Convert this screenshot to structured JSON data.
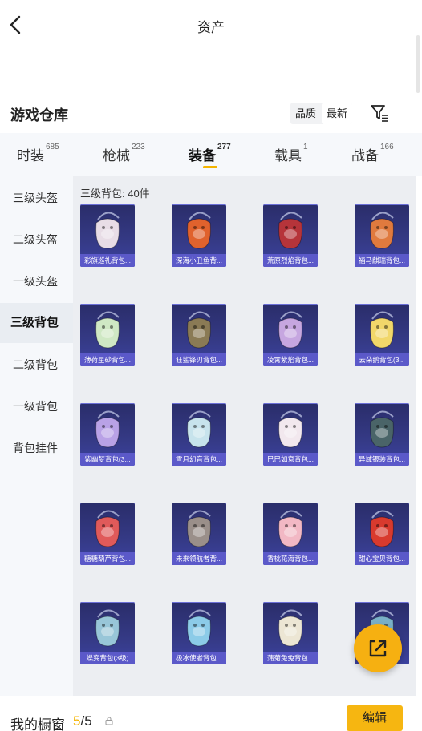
{
  "header": {
    "title": "资产",
    "back_icon": "chevron-left-icon"
  },
  "warehouse": {
    "title": "游戏仓库",
    "sort_options": [
      "品质",
      "最新"
    ],
    "sort_selected": "最新",
    "filter_icon": "filter-list-icon"
  },
  "tabs": [
    {
      "label": "时装",
      "count": "685"
    },
    {
      "label": "枪械",
      "count": "223"
    },
    {
      "label": "装备",
      "count": "277",
      "active": true
    },
    {
      "label": "载具",
      "count": "1"
    },
    {
      "label": "战备",
      "count": "166"
    }
  ],
  "sidebar": {
    "items": [
      {
        "label": "三级头盔"
      },
      {
        "label": "二级头盔"
      },
      {
        "label": "一级头盔"
      },
      {
        "label": "三级背包",
        "active": true
      },
      {
        "label": "二级背包"
      },
      {
        "label": "一级背包"
      },
      {
        "label": "背包挂件"
      }
    ]
  },
  "grid": {
    "count_label": "三级背包: 40件",
    "items": [
      {
        "name": "彩旗巡礼背包...",
        "color": "#e8dde6"
      },
      {
        "name": "深海小丑鱼背...",
        "color": "#e0622d"
      },
      {
        "name": "荒原烈焰背包...",
        "color": "#b6343a"
      },
      {
        "name": "福马麒瑞背包...",
        "color": "#e07a3e"
      },
      {
        "name": "薄荷星砂背包...",
        "color": "#cfe8c4"
      },
      {
        "name": "狂鲨锋刃背包...",
        "color": "#8a7a55"
      },
      {
        "name": "凌霄紫焰背包...",
        "color": "#c6a6e0"
      },
      {
        "name": "云朵鹅背包(3...",
        "color": "#f1d76a"
      },
      {
        "name": "紫幽梦背包(3...",
        "color": "#b9a2e6"
      },
      {
        "name": "雪月幻音背包...",
        "color": "#c7e3ec"
      },
      {
        "name": "巳巳如意背包...",
        "color": "#f2e8ee"
      },
      {
        "name": "异域银装背包...",
        "color": "#4a6468"
      },
      {
        "name": "糖糖葫芦背包...",
        "color": "#e05a5a"
      },
      {
        "name": "未来领航者背...",
        "color": "#9a8f8a"
      },
      {
        "name": "香桃花海背包...",
        "color": "#f2b8c4"
      },
      {
        "name": "甜心宝贝背包...",
        "color": "#d83a2e"
      },
      {
        "name": "蝶变背包(3级)",
        "color": "#98c6d8"
      },
      {
        "name": "极冰使者背包...",
        "color": "#8ccbe8"
      },
      {
        "name": "蒲菊兔兔背包...",
        "color": "#ece6d4"
      },
      {
        "name": "",
        "color": "#7ab0c8"
      }
    ]
  },
  "share_button": {
    "icon": "share-external-icon"
  },
  "bottom": {
    "showcase_label": "我的橱窗",
    "showcase_used": "5",
    "showcase_total": "/5",
    "lock_icon": "lock-icon",
    "edit_label": "编辑"
  },
  "colors": {
    "accent": "#f6b611",
    "card_bg": "#353a86",
    "card_label_bg": "#5b59c9"
  }
}
